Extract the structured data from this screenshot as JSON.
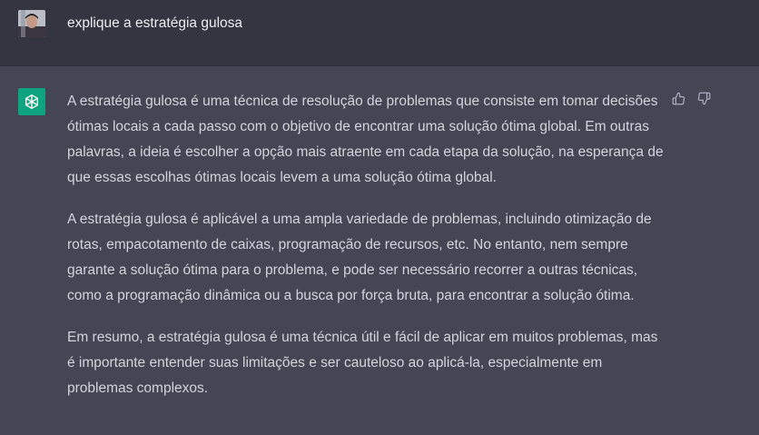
{
  "user_message": {
    "text": "explique a estratégia gulosa"
  },
  "assistant_message": {
    "paragraphs": [
      "A estratégia gulosa é uma técnica de resolução de problemas que consiste em tomar decisões ótimas locais a cada passo com o objetivo de encontrar uma solução ótima global. Em outras palavras, a ideia é escolher a opção mais atraente em cada etapa da solução, na esperança de que essas escolhas ótimas locais levem a uma solução ótima global.",
      "A estratégia gulosa é aplicável a uma ampla variedade de problemas, incluindo otimização de rotas, empacotamento de caixas, programação de recursos, etc. No entanto, nem sempre garante a solução ótima para o problema, e pode ser necessário recorrer a outras técnicas, como a programação dinâmica ou a busca por força bruta, para encontrar a solução ótima.",
      "Em resumo, a estratégia gulosa é uma técnica útil e fácil de aplicar em muitos problemas, mas é importante entender suas limitações e ser cauteloso ao aplicá-la, especialmente em problemas complexos."
    ]
  },
  "icons": {
    "assistant_avatar": "openai-logo-icon",
    "like": "thumbs-up-icon",
    "dislike": "thumbs-down-icon"
  },
  "colors": {
    "user_row_bg": "#343541",
    "assistant_row_bg": "#444654",
    "assistant_avatar_bg": "#10a37f",
    "user_text": "#ececf1",
    "assistant_text": "#d1d5db",
    "icon_color": "#acacbe"
  }
}
